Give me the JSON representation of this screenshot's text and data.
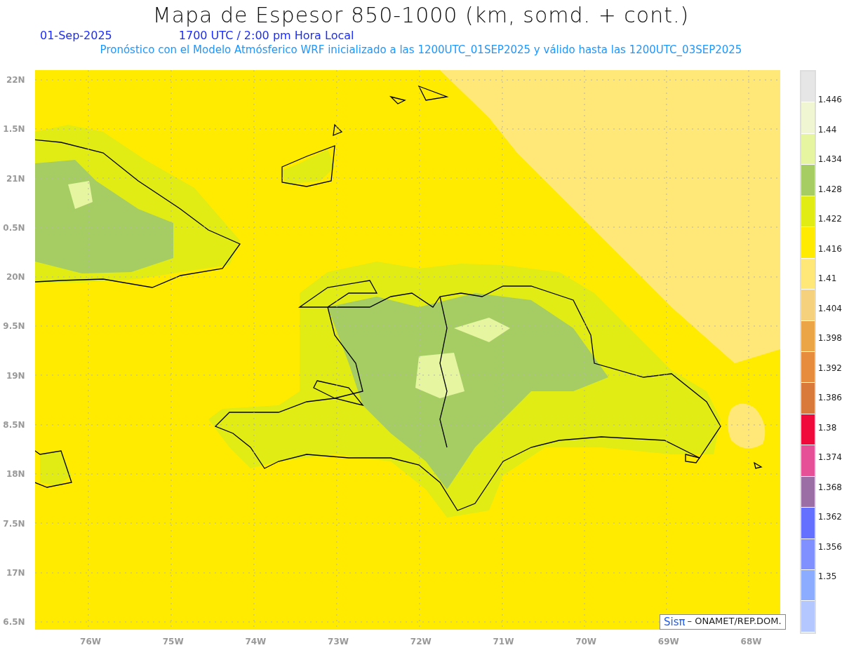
{
  "title": "Mapa de Espesor 850-1000 (km, somd. + cont.)",
  "date": "01-Sep-2025",
  "time": "1700 UTC / 2:00 pm Hora Local",
  "subtitle": "Pronóstico con el Modelo Atmósferico WRF inicializado a las 1200UTC_01SEP2025 y válido hasta las  1200UTC_03SEP2025",
  "y_axis": [
    "22N",
    "1.5N",
    "21N",
    "0.5N",
    "20N",
    "9.5N",
    "19N",
    "8.5N",
    "18N",
    "7.5N",
    "17N",
    "6.5N"
  ],
  "x_axis": [
    "76W",
    "75W",
    "74W",
    "73W",
    "72W",
    "71W",
    "70W",
    "69W",
    "68W"
  ],
  "legend": {
    "colors": [
      {
        "color": "#e6e6e6"
      },
      {
        "color": "#f0f5d2"
      },
      {
        "color": "#e6f5a0"
      },
      {
        "color": "#a5cd64"
      },
      {
        "color": "#e1eb14"
      },
      {
        "color": "#ffeb00"
      },
      {
        "color": "#ffe878"
      },
      {
        "color": "#f5d07d"
      },
      {
        "color": "#eba546"
      },
      {
        "color": "#e68c3c"
      },
      {
        "color": "#d97a3a"
      },
      {
        "color": "#f00a3c"
      },
      {
        "color": "#e65096"
      },
      {
        "color": "#9b6ea5"
      },
      {
        "color": "#6470ff"
      },
      {
        "color": "#8090ff"
      },
      {
        "color": "#8cacff"
      },
      {
        "color": "#b4c8ff"
      }
    ],
    "labels": [
      "1.446",
      "1.44",
      "1.434",
      "1.428",
      "1.422",
      "1.416",
      "1.41",
      "1.404",
      "1.398",
      "1.392",
      "1.386",
      "1.38",
      "1.374",
      "1.368",
      "1.362",
      "1.356",
      "1.35"
    ]
  },
  "credit": {
    "brand": "Sisπ",
    "text": "– ONAMET/REP.DOM."
  }
}
